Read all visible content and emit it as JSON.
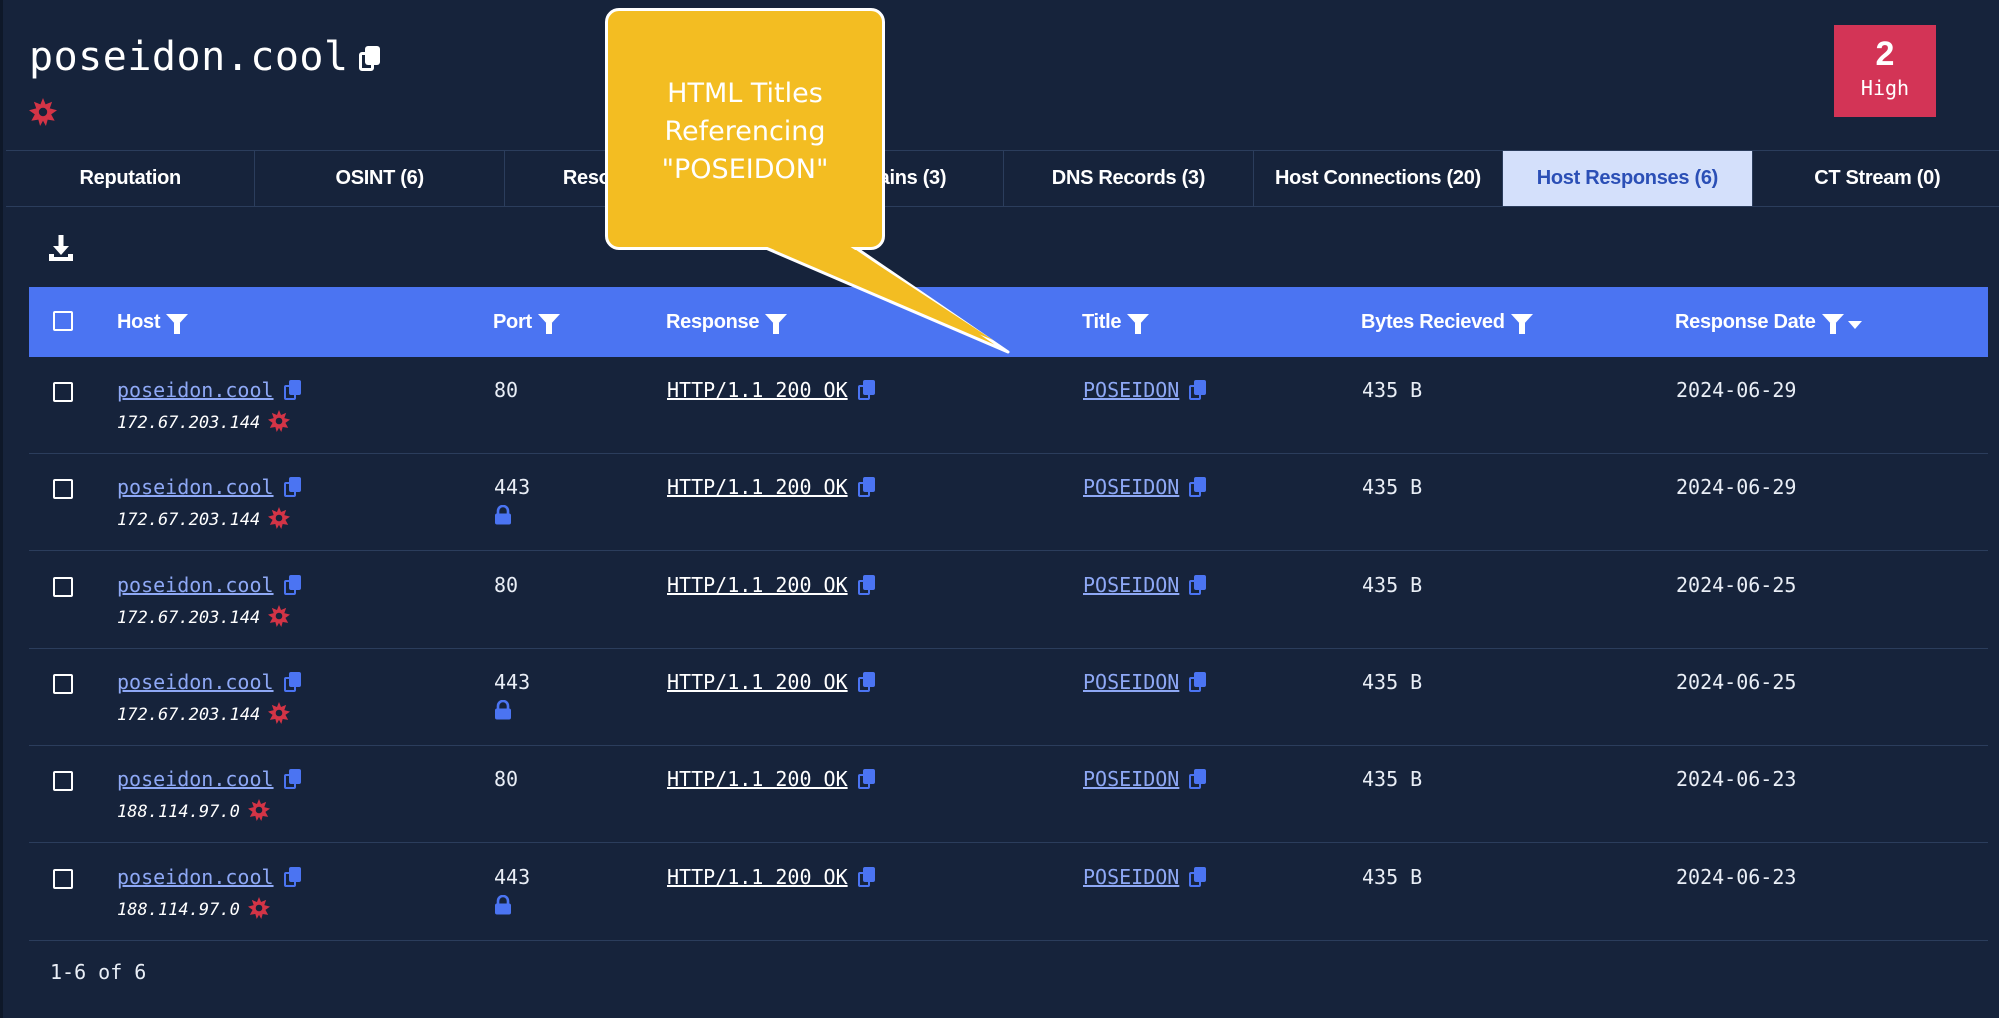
{
  "header": {
    "domain": "poseidon.cool",
    "risk": {
      "count": "2",
      "level": "High",
      "color": "#d33456"
    }
  },
  "tabs": [
    {
      "label": "Reputation",
      "active": false
    },
    {
      "label": "OSINT (6)",
      "active": false
    },
    {
      "label": "Reso",
      "active": false
    },
    {
      "label": "ains (3)",
      "active": false
    },
    {
      "label": "DNS Records (3)",
      "active": false
    },
    {
      "label": "Host Connections (20)",
      "active": false
    },
    {
      "label": "Host Responses (6)",
      "active": true
    },
    {
      "label": "CT Stream (0)",
      "active": false
    }
  ],
  "table": {
    "columns": {
      "host": "Host",
      "port": "Port",
      "response": "Response",
      "title": "Title",
      "bytes": "Bytes Recieved",
      "date": "Response Date"
    },
    "rows": [
      {
        "host": "poseidon.cool",
        "ip": "172.67.203.144",
        "port": "80",
        "secure": false,
        "response": "HTTP/1.1 200 OK",
        "title": "POSEIDON",
        "bytes": "435 B",
        "date": "2024-06-29"
      },
      {
        "host": "poseidon.cool",
        "ip": "172.67.203.144",
        "port": "443",
        "secure": true,
        "response": "HTTP/1.1 200 OK",
        "title": "POSEIDON",
        "bytes": "435 B",
        "date": "2024-06-29"
      },
      {
        "host": "poseidon.cool",
        "ip": "172.67.203.144",
        "port": "80",
        "secure": false,
        "response": "HTTP/1.1 200 OK",
        "title": "POSEIDON",
        "bytes": "435 B",
        "date": "2024-06-25"
      },
      {
        "host": "poseidon.cool",
        "ip": "172.67.203.144",
        "port": "443",
        "secure": true,
        "response": "HTTP/1.1 200 OK",
        "title": "POSEIDON",
        "bytes": "435 B",
        "date": "2024-06-25"
      },
      {
        "host": "poseidon.cool",
        "ip": "188.114.97.0",
        "port": "80",
        "secure": false,
        "response": "HTTP/1.1 200 OK",
        "title": "POSEIDON",
        "bytes": "435 B",
        "date": "2024-06-23"
      },
      {
        "host": "poseidon.cool",
        "ip": "188.114.97.0",
        "port": "443",
        "secure": true,
        "response": "HTTP/1.1 200 OK",
        "title": "POSEIDON",
        "bytes": "435 B",
        "date": "2024-06-23"
      }
    ],
    "pagination": "1-6 of 6"
  },
  "callout": {
    "lines": [
      "HTML Titles",
      "Referencing",
      "\"POSEIDON\""
    ],
    "color": "#f3bd22"
  },
  "icons": {
    "copy": "copy-icon",
    "malicious": "malicious-burst-icon",
    "lock": "lock-icon",
    "download": "download-icon",
    "filter": "filter-icon",
    "sort": "sort-desc-icon"
  }
}
